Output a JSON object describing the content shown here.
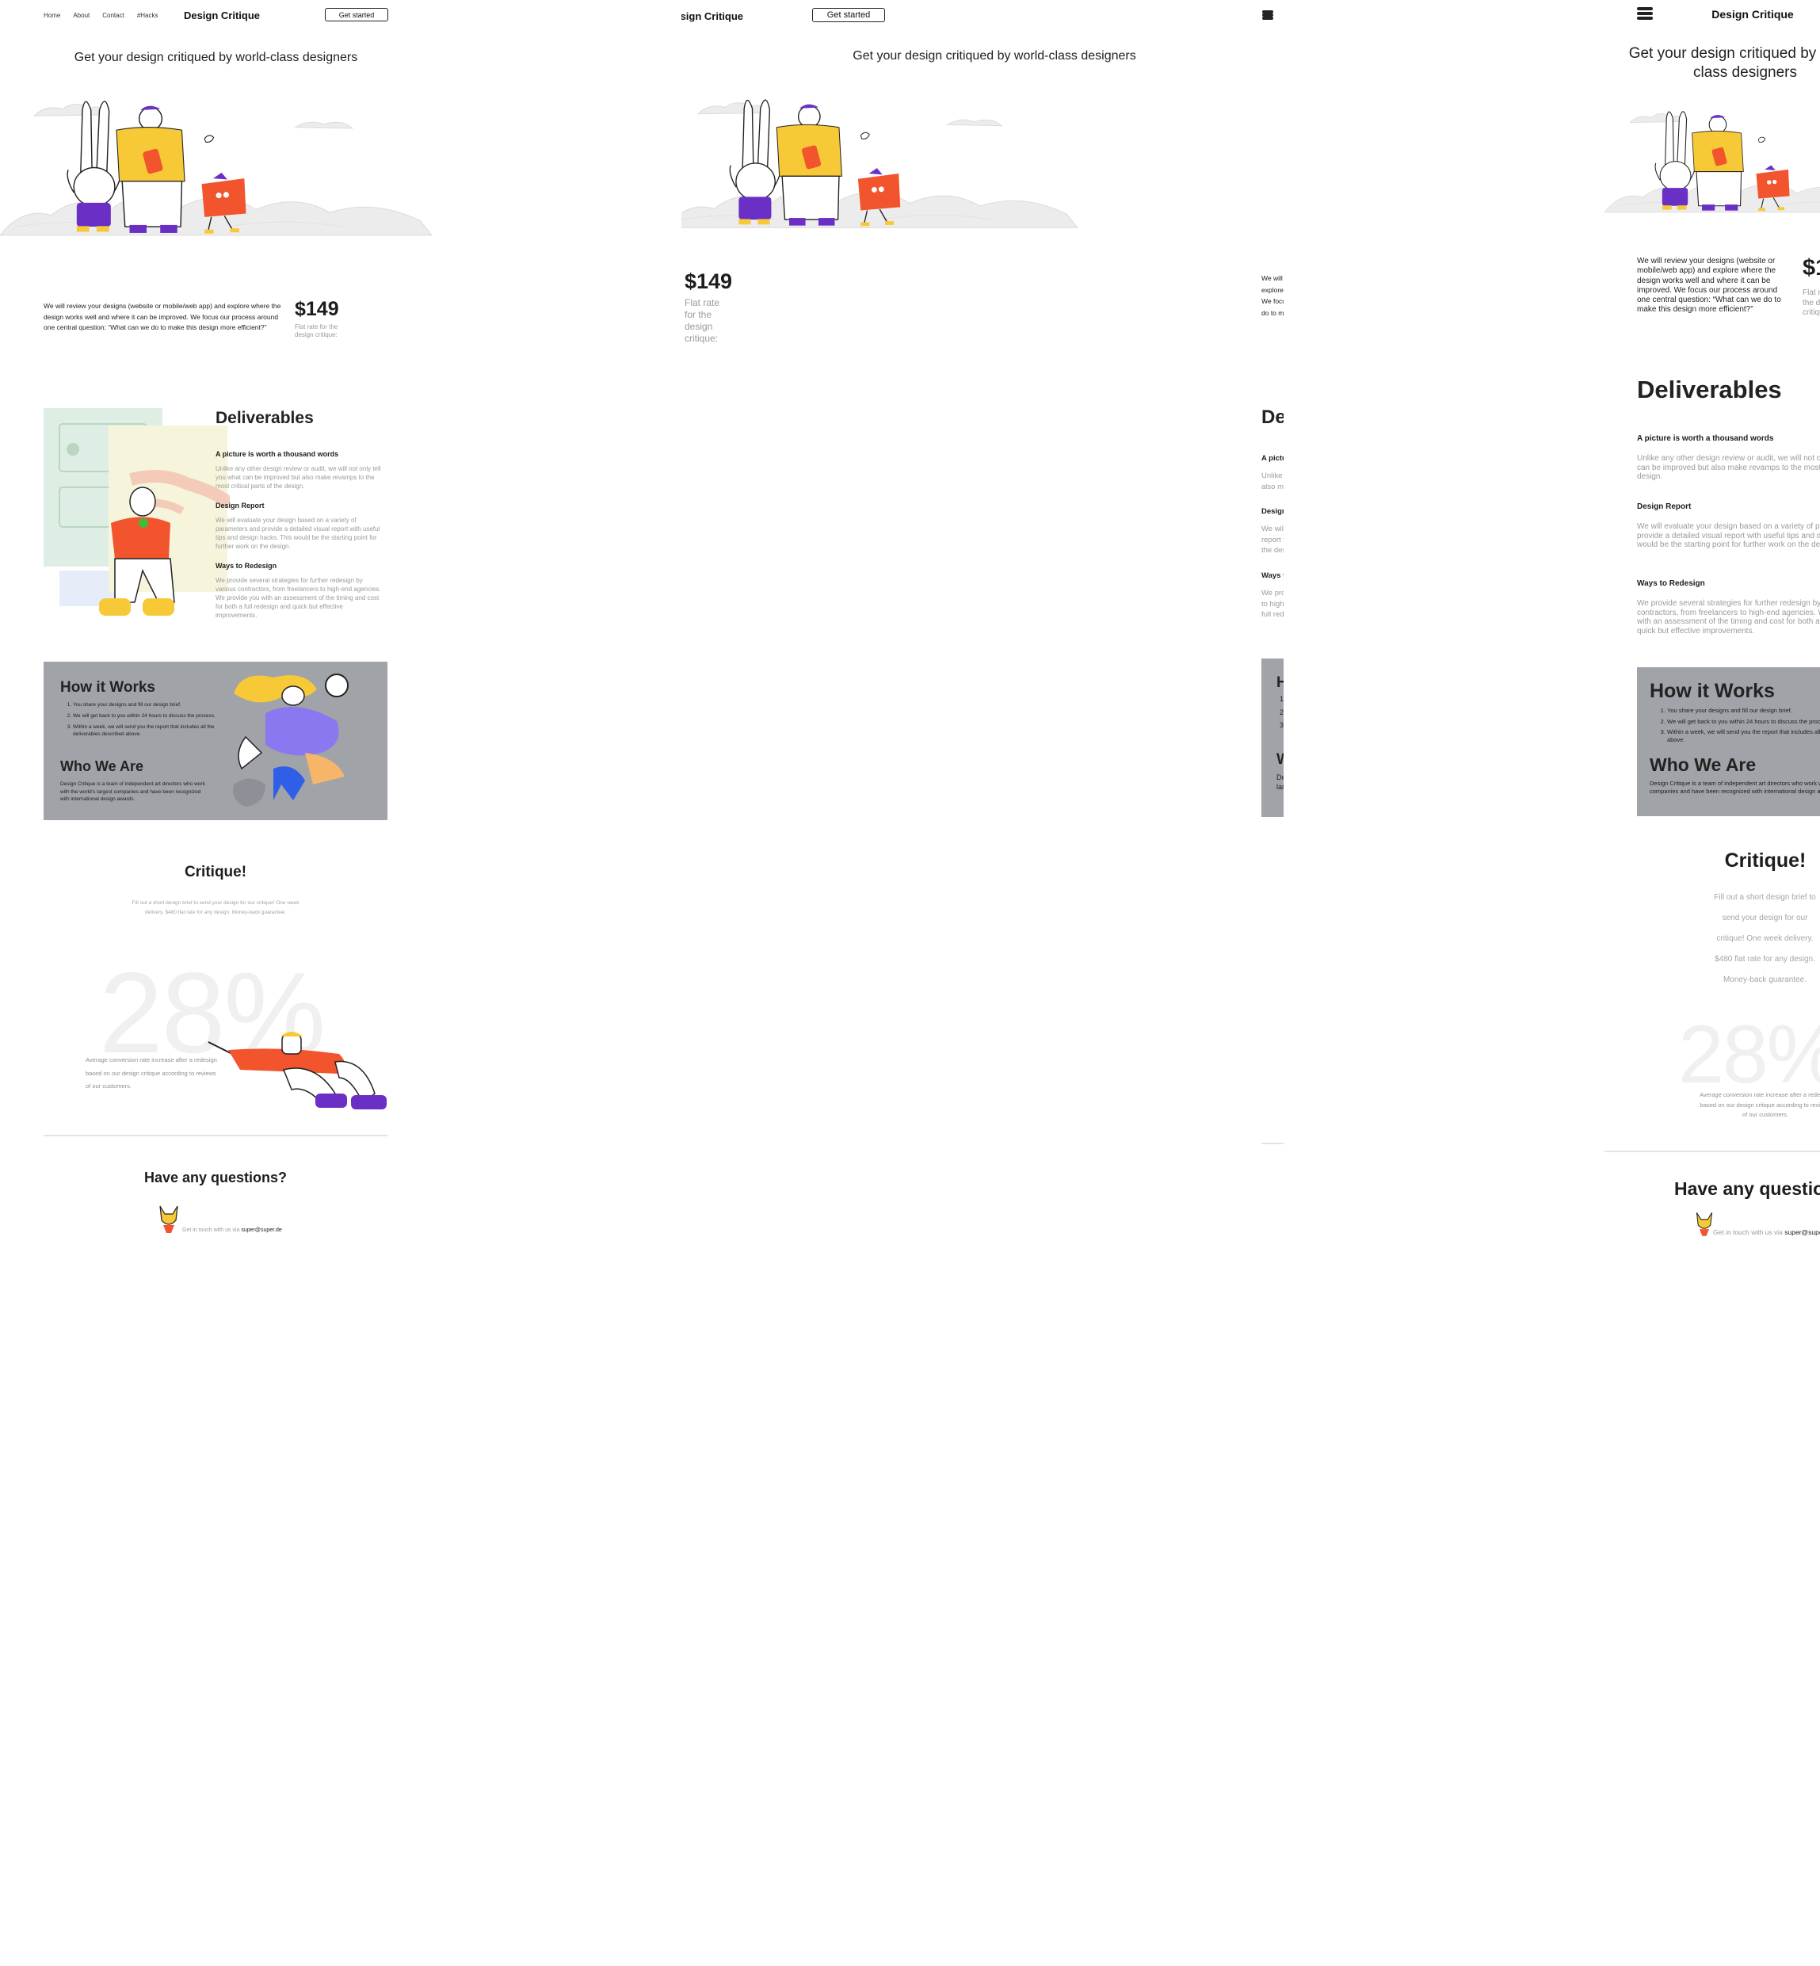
{
  "brand": "Design Critique",
  "nav": [
    "Home",
    "About",
    "Contact",
    "#Hacks"
  ],
  "cta_label": "Get started",
  "hero_title": "Get your design critiqued by world-class designers",
  "intro": "We will review your designs (website or mobile/web app) and explore where the design works well and where it can be improved. We focus our process around one central question: “What can we do to make this design more efficient?”",
  "price": "$149",
  "price_note": "Flat rate for the design critique:",
  "deliverables": {
    "title": "Deliverables",
    "items": [
      {
        "title": "A picture is worth a thousand words",
        "text": "Unlike any other design review or audit, we will not only tell you what can be improved but also make revamps to the most critical parts of the design."
      },
      {
        "title": "Design Report",
        "text": "We will evaluate your design based on a variety of parameters and provide a detailed visual report with useful tips and design hacks. This would be the starting point for further work on the design."
      },
      {
        "title": "Ways to Redesign",
        "text": "We provide several strategies for further redesign by various contractors, from freelancers to high-end agencies. We provide you with an assessment of the timing and cost for both a full redesign and quick but effective improvements."
      }
    ]
  },
  "how": {
    "title": "How it Works",
    "steps": [
      "You share your designs and fill our design brief.",
      "We will get back to you within 24 hours to discuss the process.",
      "Within a week, we will send you the report that includes all the deliverables described above."
    ]
  },
  "who": {
    "title": "Who We Are",
    "text": "Design Critique is a team of independent art directors who work with the world’s largest companies and have been recognized with international design awards."
  },
  "critique": {
    "title": "Critique!",
    "text": "Fill out a short design brief to send your design for our critique! One week delivery. $480 flat rate for any design. Money-back guarantee."
  },
  "stat": {
    "value": "28%",
    "caption": "Average conversion rate increase after a redesign based on our design critique according to reviews of our customers."
  },
  "questions": {
    "title": "Have any questions?",
    "contact_prefix": "Get in touch with us via",
    "email": "super@super.de"
  },
  "colors": {
    "yellow": "#f7c936",
    "purple": "#6a2fc4",
    "violet": "#8a78f0",
    "red": "#f2542d",
    "gray_panel": "#a0a3a8"
  }
}
